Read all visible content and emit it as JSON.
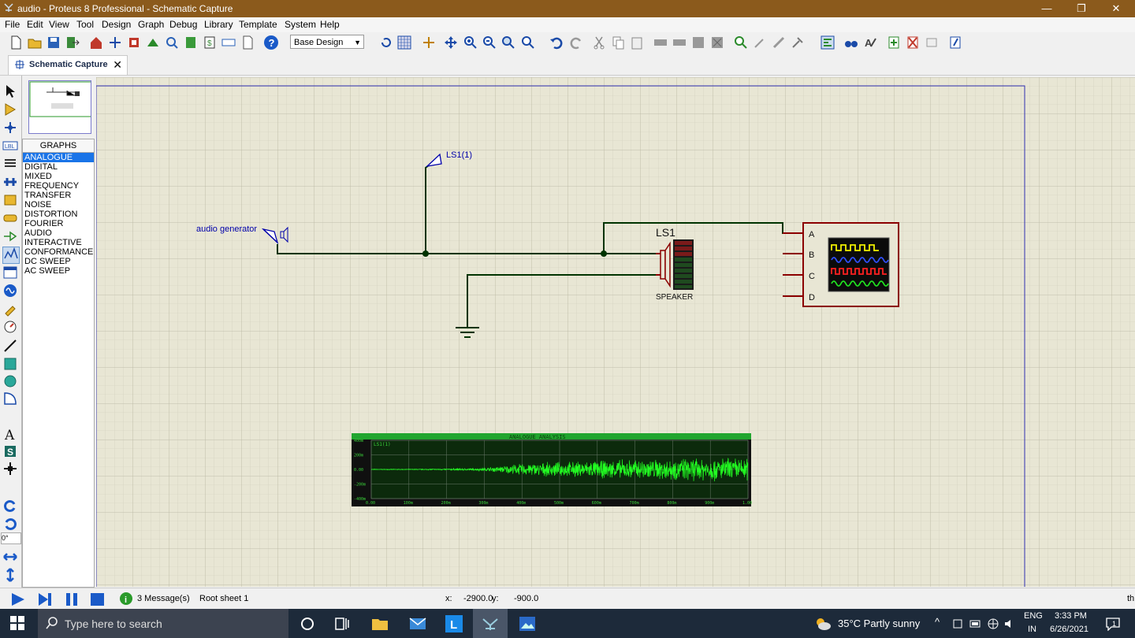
{
  "window": {
    "title": "audio  - Proteus 8 Professional - Schematic Capture",
    "minimize": "—",
    "maximize": "❐",
    "close": "✕"
  },
  "menu": [
    "File",
    "Edit",
    "View",
    "Tool",
    "Design",
    "Graph",
    "Debug",
    "Library",
    "Template",
    "System",
    "Help"
  ],
  "toolbar": {
    "design_select": "Base Design"
  },
  "tab": {
    "label": "Schematic Capture",
    "close": "✕"
  },
  "graphs_panel": {
    "header": "GRAPHS",
    "items": [
      "ANALOGUE",
      "DIGITAL",
      "MIXED",
      "FREQUENCY",
      "TRANSFER",
      "NOISE",
      "DISTORTION",
      "FOURIER",
      "AUDIO",
      "INTERACTIVE",
      "CONFORMANCE",
      "DC SWEEP",
      "AC SWEEP"
    ],
    "selected": "ANALOGUE"
  },
  "rotation": "0°",
  "schematic": {
    "generator_label": "audio generator",
    "probe_label": "LS1(1)",
    "speaker_ref": "LS1",
    "speaker_name": "SPEAKER",
    "scope_channels": [
      "A",
      "B",
      "C",
      "D"
    ],
    "colors": {
      "wire": "#003300",
      "component": "#8b0000",
      "label": "#0000aa"
    }
  },
  "analysis_graph": {
    "title": "ANALOGUE ANALYSIS",
    "trace_label": "LS1(1)",
    "y_ticks": [
      "400m",
      "200m",
      "0.00",
      "-200m",
      "-400m"
    ],
    "x_ticks": [
      "0.00",
      "100m",
      "200m",
      "300m",
      "400m",
      "500m",
      "600m",
      "700m",
      "800m",
      "900m",
      "1.00"
    ]
  },
  "chart_data": {
    "type": "line",
    "title": "ANALOGUE ANALYSIS",
    "series": [
      {
        "name": "LS1(1)"
      }
    ],
    "xlim": [
      0,
      1
    ],
    "ylim": [
      -0.4,
      0.4
    ],
    "x_envelope": [
      0.0,
      0.1,
      0.2,
      0.3,
      0.35,
      0.4,
      0.5,
      0.6,
      0.7,
      0.8,
      0.9,
      1.0
    ],
    "y_amplitude_envelope": [
      0.005,
      0.005,
      0.01,
      0.02,
      0.05,
      0.08,
      0.1,
      0.12,
      0.14,
      0.15,
      0.16,
      0.16
    ]
  },
  "status": {
    "messages": "3 Message(s)",
    "sheet": "Root sheet 1",
    "x_label": "x:",
    "x_value": "-2900.0",
    "y_label": "y:",
    "y_value": "-900.0",
    "right_text": "th"
  },
  "taskbar": {
    "search_placeholder": "Type here to search",
    "weather": "35°C  Partly sunny",
    "lang_top": "ENG",
    "lang_bottom": "IN",
    "time": "3:33 PM",
    "date": "6/26/2021",
    "notif_count": "1"
  }
}
